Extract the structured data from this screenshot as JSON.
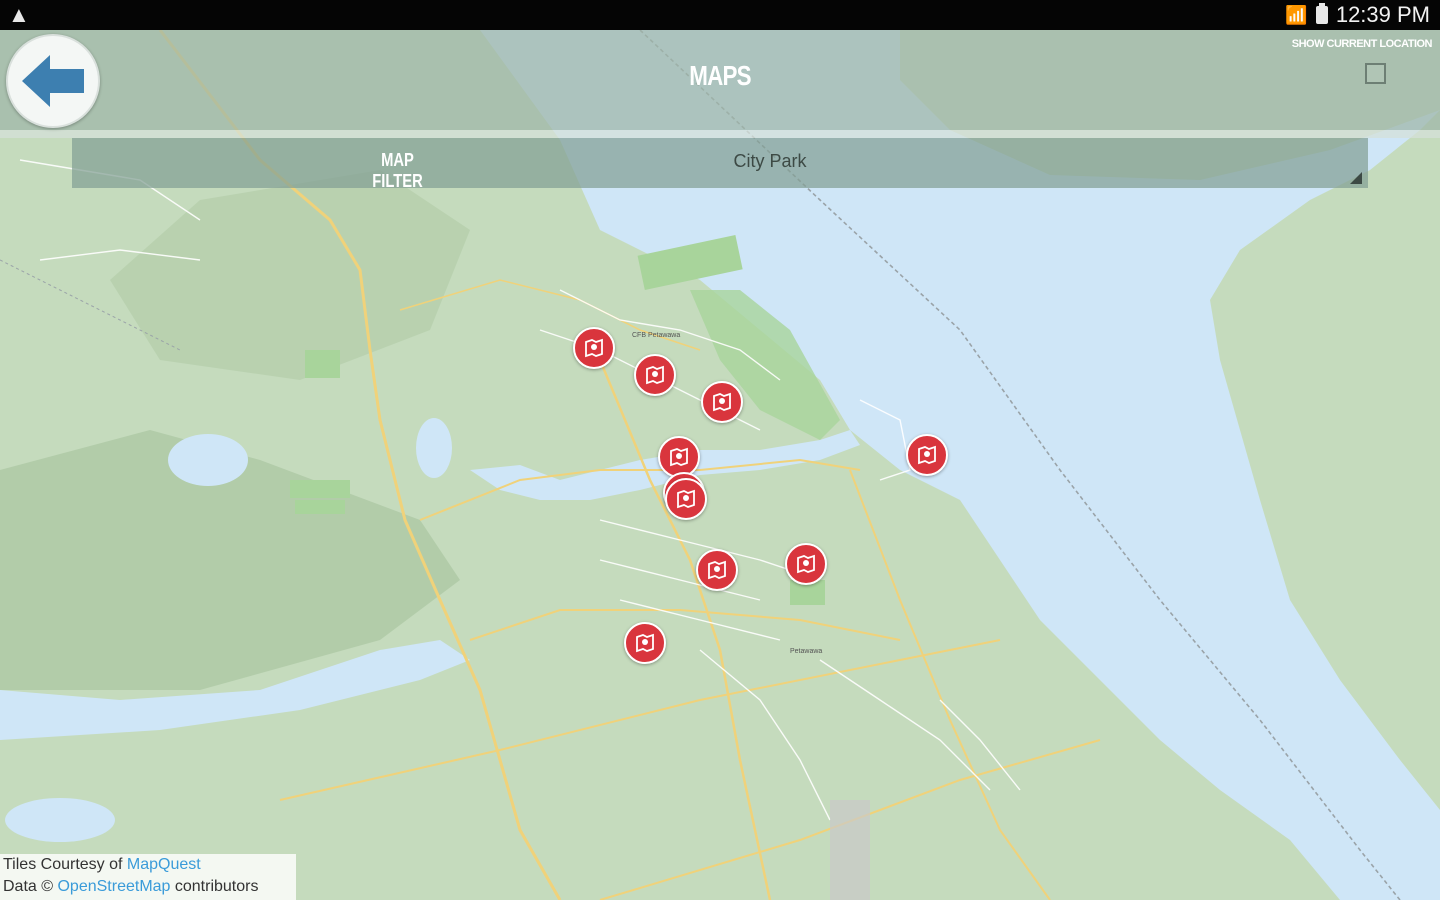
{
  "status_bar": {
    "warning_icon": "warning-icon",
    "time": "12:39 PM"
  },
  "header": {
    "title": "MAPS",
    "back_icon": "back-arrow-icon",
    "show_location_label": "SHOW CURRENT LOCATION",
    "show_location_checked": false
  },
  "filter": {
    "label": "MAP FILTER",
    "selected": "City Park"
  },
  "map": {
    "labels": [
      "CFB Petawawa",
      "Petawawa"
    ],
    "markers": [
      "park-marker-icon",
      "park-marker-icon",
      "park-marker-icon",
      "park-marker-icon",
      "park-marker-icon",
      "park-marker-icon",
      "park-marker-icon",
      "park-marker-icon",
      "park-marker-icon",
      "park-marker-icon"
    ]
  },
  "attribution": {
    "tiles_prefix": "Tiles Courtesy of ",
    "tiles_link": "MapQuest",
    "data_prefix": "Data © ",
    "data_link": "OpenStreetMap",
    "data_suffix": " contributors"
  },
  "colors": {
    "marker": "#d9353d",
    "water": "#cfe6f7",
    "land": "#c5dbbd",
    "back_arrow": "#3d7fb0"
  }
}
